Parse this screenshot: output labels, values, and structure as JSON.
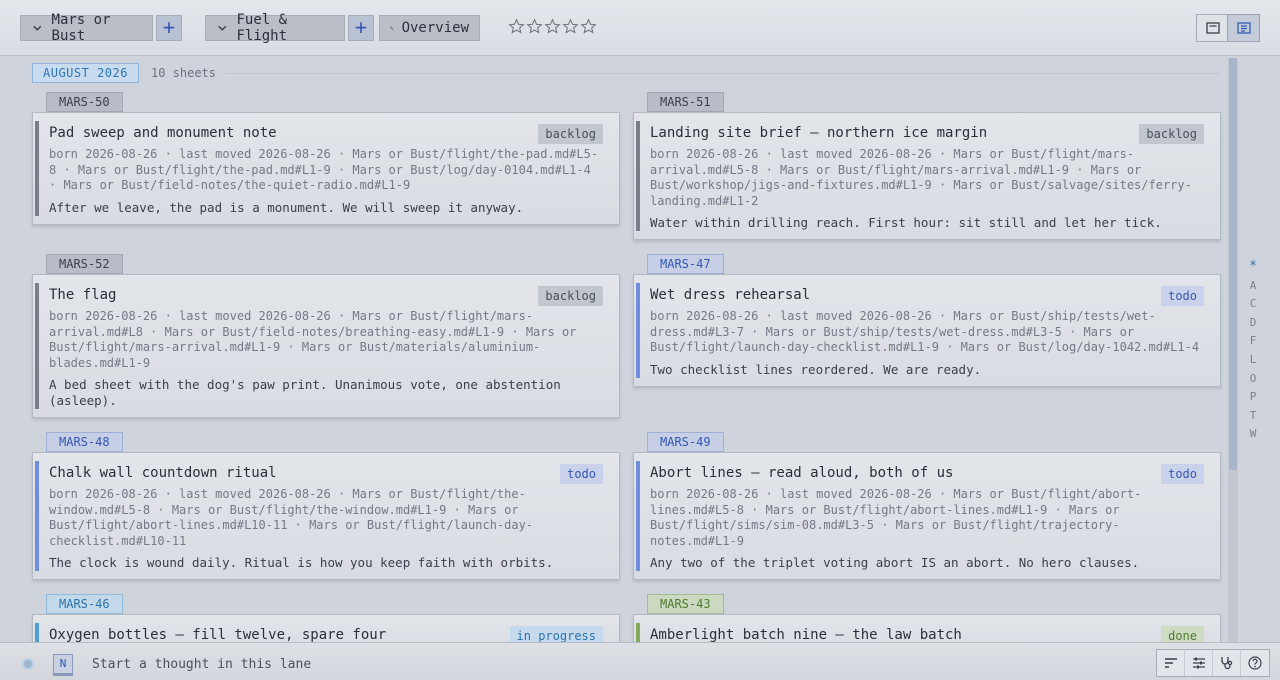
{
  "toolbar": {
    "project_label": "Mars or Bust",
    "lane_label": "Fuel & Flight",
    "overview_label": "Overview",
    "plus_label": "+",
    "rating": 0
  },
  "month": {
    "label": "AUGUST 2026",
    "count": "10 sheets"
  },
  "cards": [
    {
      "id": "MARS-50",
      "title": "Pad sweep and monument note",
      "status": "backlog",
      "meta": "born 2026-08-26  ·  last moved 2026-08-26  ·  Mars or Bust/flight/the-pad.md#L5-8 · Mars or Bust/flight/the-pad.md#L1-9 · Mars or Bust/log/day-0104.md#L1-4 · Mars or Bust/field-notes/the-quiet-radio.md#L1-9",
      "desc": "After we leave, the pad is a monument. We will sweep it anyway."
    },
    {
      "id": "MARS-51",
      "title": "Landing site brief — northern ice margin",
      "status": "backlog",
      "meta": "born 2026-08-26  ·  last moved 2026-08-26  ·  Mars or Bust/flight/mars-arrival.md#L5-8 · Mars or Bust/flight/mars-arrival.md#L1-9 · Mars or Bust/workshop/jigs-and-fixtures.md#L1-9 · Mars or Bust/salvage/sites/ferry-landing.md#L1-2",
      "desc": "Water within drilling reach. First hour: sit still and let her tick."
    },
    {
      "id": "MARS-52",
      "title": "The flag",
      "status": "backlog",
      "meta": "born 2026-08-26  ·  last moved 2026-08-26  ·  Mars or Bust/flight/mars-arrival.md#L8 · Mars or Bust/field-notes/breathing-easy.md#L1-9 · Mars or Bust/flight/mars-arrival.md#L1-9 · Mars or Bust/materials/aluminium-blades.md#L1-9",
      "desc": "A bed sheet with the dog's paw print. Unanimous vote, one abstention (asleep)."
    },
    {
      "id": "MARS-47",
      "title": "Wet dress rehearsal",
      "status": "todo",
      "meta": "born 2026-08-26  ·  last moved 2026-08-26  ·  Mars or Bust/ship/tests/wet-dress.md#L3-7 · Mars or Bust/ship/tests/wet-dress.md#L3-5 · Mars or Bust/flight/launch-day-checklist.md#L1-9 · Mars or Bust/log/day-1042.md#L1-4",
      "desc": "Two checklist lines reordered. We are ready."
    },
    {
      "id": "MARS-48",
      "title": "Chalk wall countdown ritual",
      "status": "todo",
      "meta": "born 2026-08-26  ·  last moved 2026-08-26  ·  Mars or Bust/flight/the-window.md#L5-8 · Mars or Bust/flight/the-window.md#L1-9 · Mars or Bust/flight/abort-lines.md#L10-11 · Mars or Bust/flight/launch-day-checklist.md#L10-11",
      "desc": "The clock is wound daily. Ritual is how you keep faith with orbits."
    },
    {
      "id": "MARS-49",
      "title": "Abort lines — read aloud, both of us",
      "status": "todo",
      "meta": "born 2026-08-26  ·  last moved 2026-08-26  ·  Mars or Bust/flight/abort-lines.md#L5-8 · Mars or Bust/flight/abort-lines.md#L1-9 · Mars or Bust/flight/sims/sim-08.md#L3-5 · Mars or Bust/flight/trajectory-notes.md#L1-9",
      "desc": "Any two of the triplet voting abort IS an abort. No hero clauses."
    },
    {
      "id": "MARS-46",
      "title": "Oxygen bottles — fill twelve, spare four",
      "status": "in progress",
      "meta": "",
      "desc": ""
    },
    {
      "id": "MARS-43",
      "title": "Amberlight batch nine — the law batch",
      "status": "done",
      "meta": "",
      "desc": ""
    }
  ],
  "alpha_index": [
    "*",
    "A",
    "C",
    "D",
    "F",
    "L",
    "O",
    "P",
    "T",
    "W"
  ],
  "bottom": {
    "badge": "N",
    "placeholder": "Start a thought in this lane"
  },
  "colors": {
    "accent": "#3457b2",
    "month": "#2d74b7",
    "done": "#4f7a2e"
  },
  "icons": [
    "chevron-down-icon",
    "plus-icon",
    "overview-icon",
    "star-icon",
    "card-view-icon",
    "list-view-icon",
    "sort-icon",
    "sliders-icon",
    "stethoscope-icon",
    "help-icon"
  ]
}
